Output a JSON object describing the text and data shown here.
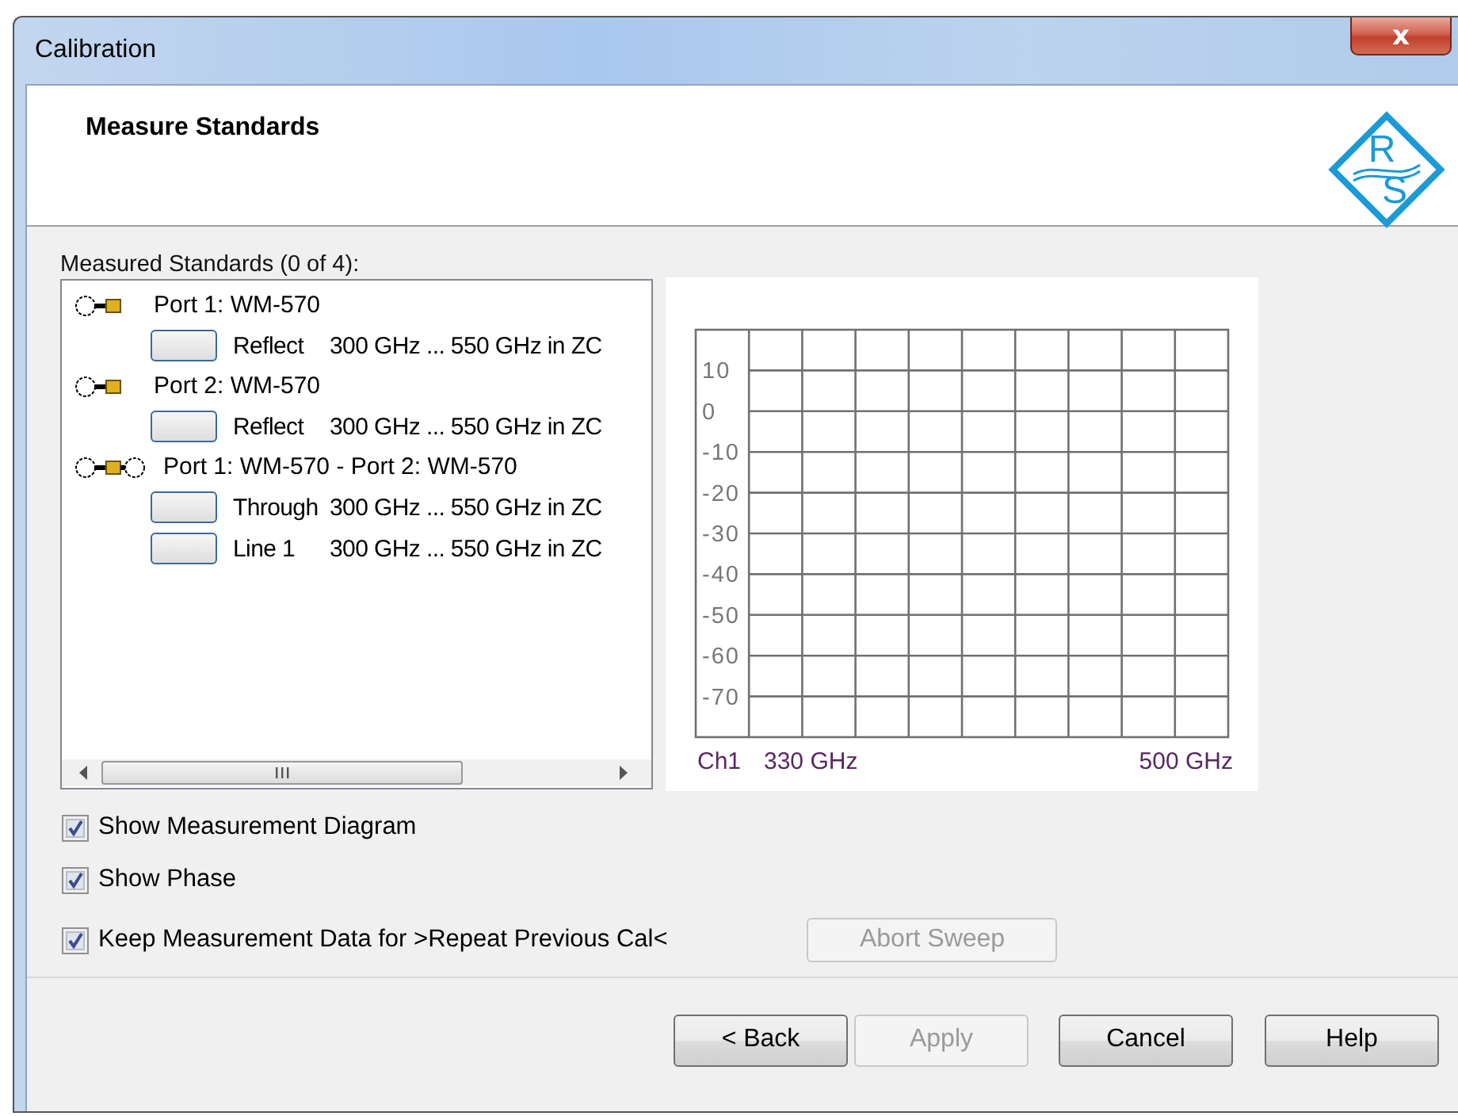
{
  "window": {
    "title": "Calibration",
    "close": "x"
  },
  "header": {
    "title": "Measure Standards",
    "logo_letters": [
      "R",
      "S"
    ]
  },
  "standards": {
    "label": "Measured Standards (0 of 4):",
    "tree": [
      {
        "label": "Port 1: WM-570",
        "kind": "single",
        "children": [
          {
            "name": "Reflect",
            "range": "300 GHz ... 550 GHz in ZC"
          }
        ]
      },
      {
        "label": "Port 2: WM-570",
        "kind": "single",
        "children": [
          {
            "name": "Reflect",
            "range": "300 GHz ... 550 GHz in ZC"
          }
        ]
      },
      {
        "label": "Port 1: WM-570 - Port 2: WM-570",
        "kind": "pair",
        "children": [
          {
            "name": "Through",
            "range": "300 GHz ... 550 GHz in ZC"
          },
          {
            "name": "Line 1",
            "range": "300 GHz ... 550 GHz in ZC"
          }
        ]
      }
    ]
  },
  "diagram": {
    "y_labels": [
      "10",
      "0",
      "-10",
      "-20",
      "-30",
      "-40",
      "-50",
      "-60",
      "-70"
    ],
    "channel": "Ch1",
    "start": "330 GHz",
    "stop": "500 GHz"
  },
  "options": [
    {
      "label": "Show Measurement Diagram",
      "checked": true
    },
    {
      "label": "Show Phase",
      "checked": true
    },
    {
      "label": "Keep Measurement Data for >Repeat Previous Cal<",
      "checked": true
    }
  ],
  "abort_button": {
    "label": "Abort Sweep",
    "disabled": true
  },
  "buttons": [
    {
      "label": "< Back",
      "disabled": false
    },
    {
      "label": "Apply",
      "disabled": true
    },
    {
      "label": "Cancel",
      "disabled": false
    },
    {
      "label": "Help",
      "disabled": false
    }
  ]
}
